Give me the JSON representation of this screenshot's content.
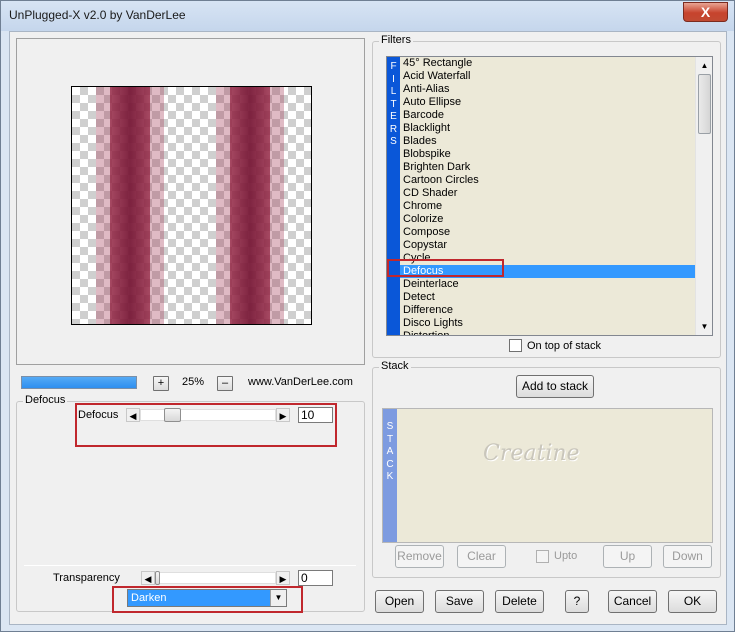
{
  "window": {
    "title": "UnPlugged-X v2.0 by VanDerLee",
    "close_label": "X"
  },
  "colors": {
    "accent": "#0a57d8",
    "selection": "#3399ff",
    "highlight_box": "#c0272d",
    "preview_band": "#a33a55"
  },
  "preview": {
    "zoom": "25%",
    "zoom_in": "+",
    "zoom_out": "–",
    "website": "www.VanDerLee.com",
    "progress_fraction": 1.0
  },
  "filters": {
    "title": "Filters",
    "strip_label": "FILTERS",
    "items": [
      "45° Rectangle",
      "Acid Waterfall",
      "Anti-Alias",
      "Auto Ellipse",
      "Barcode",
      "Blacklight",
      "Blades",
      "Blobspike",
      "Brighten Dark",
      "Cartoon Circles",
      "CD Shader",
      "Chrome",
      "Colorize",
      "Compose",
      "Copystar",
      "Cycle",
      "Defocus",
      "Deinterlace",
      "Detect",
      "Difference",
      "Disco Lights",
      "Distortion"
    ],
    "selected": "Defocus",
    "on_top_of_stack": "On top of stack"
  },
  "stack": {
    "title": "Stack",
    "add_to_stack": "Add to stack",
    "strip_label": "STACK",
    "watermark": "Creatine",
    "remove": "Remove",
    "clear": "Clear",
    "upto": "Upto",
    "up": "Up",
    "down": "Down"
  },
  "params": {
    "group_title": "Defocus",
    "defocus_label": "Defocus",
    "defocus_value": "10",
    "transparency_label": "Transparency",
    "transparency_value": "0",
    "blend_mode": "Darken"
  },
  "footer": {
    "open": "Open",
    "save": "Save",
    "delete": "Delete",
    "help": "?",
    "cancel": "Cancel",
    "ok": "OK"
  }
}
